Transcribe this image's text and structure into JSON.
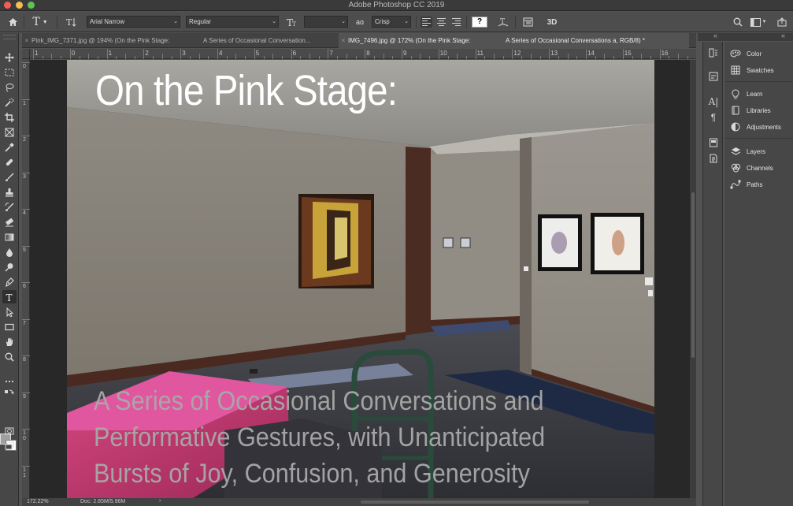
{
  "window": {
    "title": "Adobe Photoshop CC 2019"
  },
  "options_bar": {
    "font_family": "Arial Narrow",
    "font_style": "Regular",
    "font_size": "",
    "antialias_label": "aɑ",
    "antialias": "Crisp",
    "warp_label": "?",
    "threed_label": "3D"
  },
  "tabs": [
    {
      "label": "Pink_IMG_7371.jpg @ 194% (On the Pink Stage:",
      "active": false
    },
    {
      "label": "A Series of Occasional Conversation...",
      "active": false
    },
    {
      "label": "IMG_7496.jpg @ 172% (On the Pink Stage:",
      "active": true
    },
    {
      "label": "A Series of Occasional Conversations a, RGB/8) *",
      "active": true
    }
  ],
  "ruler": {
    "h_labels": [
      "1",
      "0",
      "1",
      "2",
      "3",
      "4",
      "5",
      "6",
      "7",
      "8",
      "9",
      "10",
      "11",
      "12",
      "13",
      "14",
      "15",
      "16"
    ],
    "v_labels": [
      "0",
      "1",
      "2",
      "3",
      "4",
      "5",
      "6",
      "7",
      "8",
      "9",
      "1 0",
      "1 1"
    ]
  },
  "canvas": {
    "headline": "On the Pink Stage:",
    "sub_lines": [
      "A Series of Occasional Conversations and",
      "Performative Gestures, with Unanticipated",
      "Bursts of Joy, Confusion, and Generosity"
    ]
  },
  "status": {
    "zoom": "172.22%",
    "doc_size": "Doc: 2.85M/5.96M",
    "arrow": "›"
  },
  "panels": {
    "collapse_left": "«",
    "collapse_right": "«",
    "items": [
      {
        "label": "Color",
        "icon": "color-wheel-icon"
      },
      {
        "label": "Swatches",
        "icon": "swatches-grid-icon"
      },
      {
        "label": "Learn",
        "icon": "lightbulb-icon"
      },
      {
        "label": "Libraries",
        "icon": "libraries-icon"
      },
      {
        "label": "Adjustments",
        "icon": "adjustments-icon"
      },
      {
        "label": "Layers",
        "icon": "layers-icon"
      },
      {
        "label": "Channels",
        "icon": "channels-icon"
      },
      {
        "label": "Paths",
        "icon": "paths-icon"
      }
    ]
  },
  "colors": {
    "foreground": "#a0a0a0",
    "background": "#ffffff",
    "headline_text": "#ffffff",
    "sub_text": "#a9a9a9"
  }
}
